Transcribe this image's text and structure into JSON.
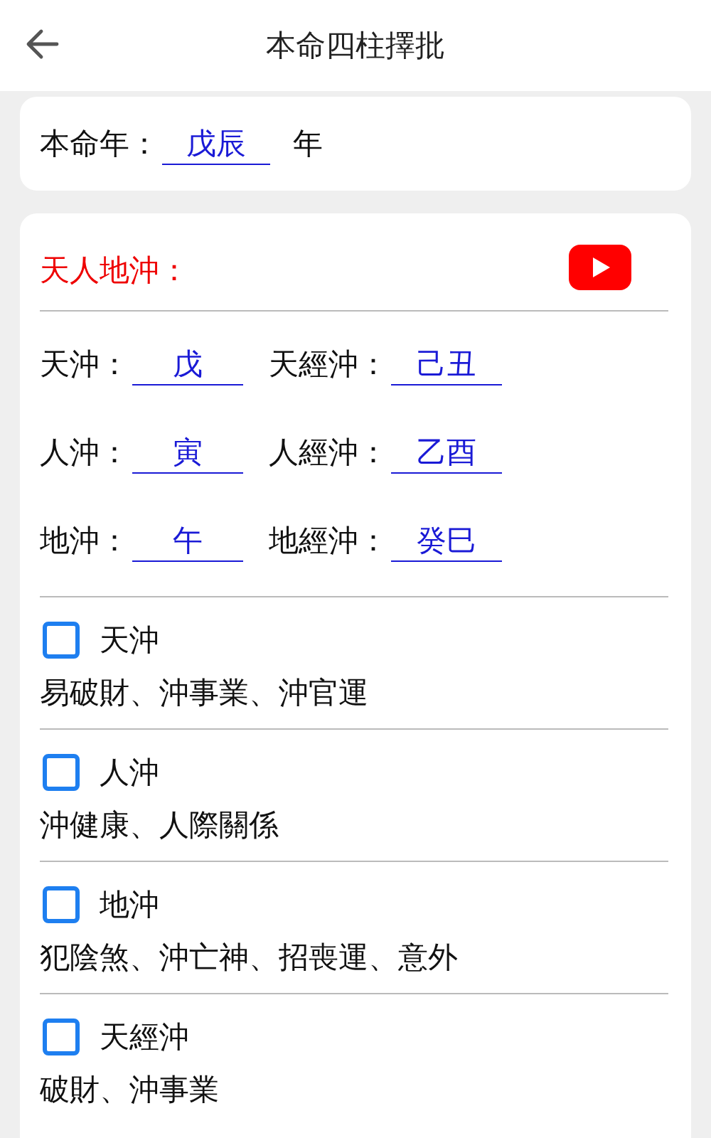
{
  "header": {
    "title": "本命四柱擇批"
  },
  "birth_year": {
    "label": "本命年：",
    "value": "戊辰",
    "suffix": "年"
  },
  "clash": {
    "title": "天人地沖：",
    "pairs": [
      {
        "label": "天沖：",
        "value": "戊",
        "label_2": "天經沖：",
        "value_2": "己丑"
      },
      {
        "label": "人沖：",
        "value": "寅",
        "label_2": "人經沖：",
        "value_2": "乙酉"
      },
      {
        "label": "地沖：",
        "value": "午",
        "label_2": "地經沖：",
        "value_2": "癸巳"
      }
    ],
    "items": [
      {
        "label": "天沖",
        "checked": false,
        "description": "易破財、沖事業、沖官運"
      },
      {
        "label": "人沖",
        "checked": false,
        "description": "沖健康、人際關係"
      },
      {
        "label": "地沖",
        "checked": false,
        "description": "犯陰煞、沖亡神、招喪運、意外"
      },
      {
        "label": "天經沖",
        "checked": false,
        "description": "破財、沖事業"
      }
    ]
  }
}
